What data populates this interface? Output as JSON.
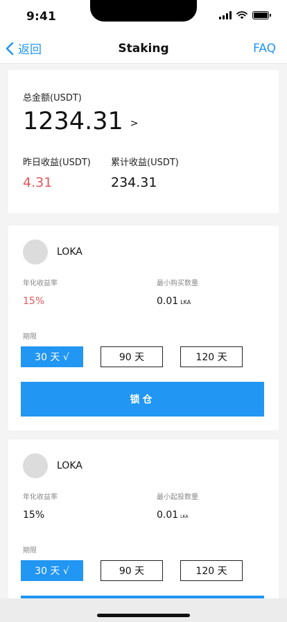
{
  "status_bar": {
    "time": "9:41"
  },
  "nav": {
    "back_label": "返回",
    "title": "Staking",
    "faq_label": "FAQ"
  },
  "summary": {
    "total_label": "总金额(USDT)",
    "total_value": "1234.31",
    "total_arrow": ">",
    "yesterday_label": "昨日收益(USDT)",
    "yesterday_value": "4.31",
    "cumulative_label": "累计收益(USDT)",
    "cumulative_value": "234.31"
  },
  "products": [
    {
      "coin": "LOKA",
      "rate_label": "年化收益率",
      "rate_value": "15%",
      "min_label": "最小购买数量",
      "min_value": "0.01",
      "min_unit": "LKA",
      "term_label": "期限",
      "terms": [
        "30 天 √",
        "90 天",
        "120 天"
      ],
      "action_label": "锁仓"
    },
    {
      "coin": "LOKA",
      "rate_label": "年化收益率",
      "rate_value": "15%",
      "min_label": "最小起投数量",
      "min_value": "0.01",
      "min_unit": "LKA",
      "term_label": "期限",
      "terms": [
        "30 天 √",
        "90 天",
        "120 天"
      ],
      "action_label": ""
    }
  ],
  "colors": {
    "accent": "#2196f3",
    "profit_red": "#e0585b",
    "avatar_grey": "#dcdcdc"
  }
}
